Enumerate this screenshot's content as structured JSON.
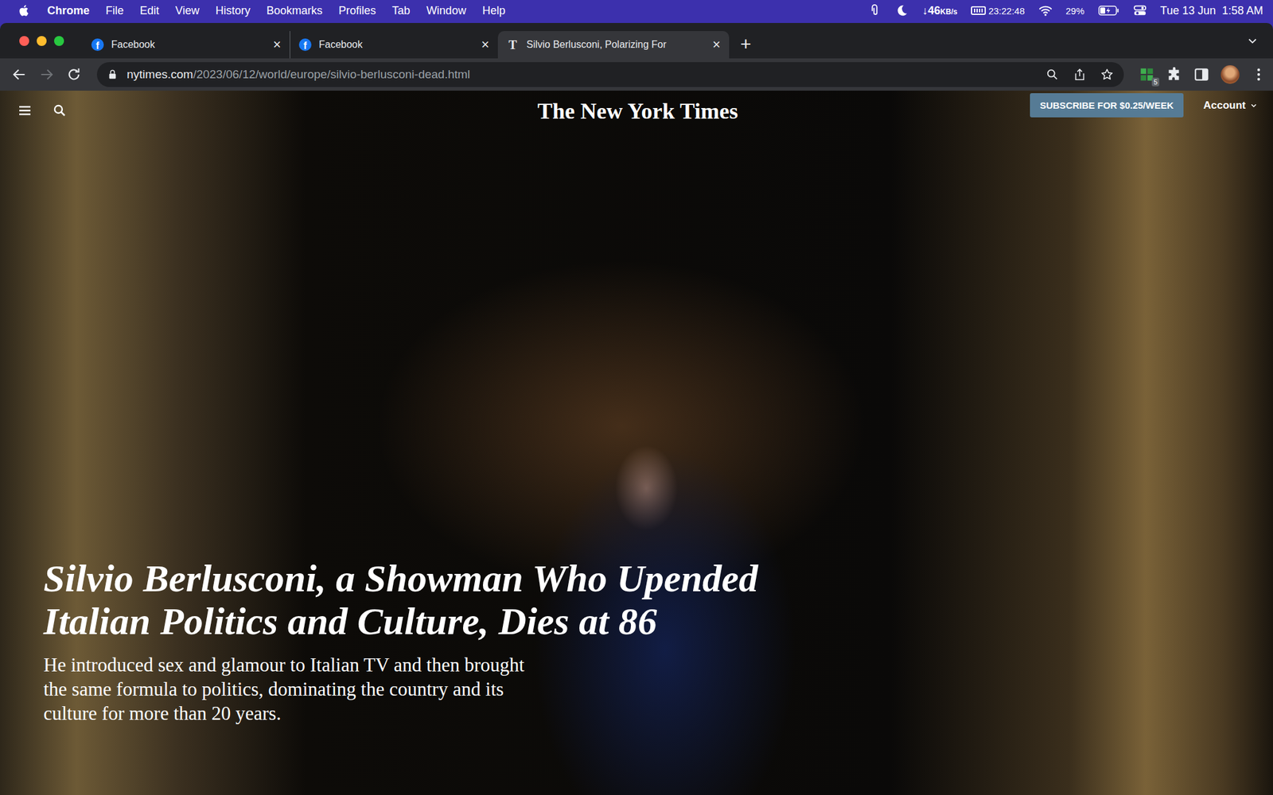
{
  "menu_bar": {
    "app": "Chrome",
    "items": [
      "File",
      "Edit",
      "View",
      "History",
      "Bookmarks",
      "Profiles",
      "Tab",
      "Window",
      "Help"
    ],
    "network": {
      "value": "↓46",
      "unit": "KB/s"
    },
    "timer": "23:22:48",
    "battery": "29%",
    "clock": "Tue 13 Jun  1:58 AM"
  },
  "tabs": [
    {
      "label": "Facebook",
      "favicon": "f",
      "kind": "facebook",
      "selected": false,
      "close": "×"
    },
    {
      "label": "Facebook",
      "favicon": "f",
      "kind": "facebook",
      "selected": false,
      "close": "×"
    },
    {
      "label": "Silvio Berlusconi, Polarizing For",
      "favicon": "T",
      "kind": "nyt",
      "selected": true,
      "close": "×"
    }
  ],
  "new_tab": "+",
  "toolbar": {
    "url_host": "nytimes.com",
    "url_path": "/2023/06/12/world/europe/silvio-berlusconi-dead.html",
    "back_disabled": false,
    "forward_disabled": true,
    "extension_badge": "5"
  },
  "page": {
    "logo": "The New York Times",
    "subscribe": "SUBSCRIBE FOR $0.25/WEEK",
    "account": "Account",
    "headline_lines": [
      "Silvio Berlusconi, a Showman Who Upended",
      "Italian Politics and Culture, Dies at 86"
    ],
    "summary_lines": [
      "He introduced sex and glamour to Italian TV and then brought",
      "the same formula to politics, dominating the country and its",
      "culture for more than 20 years."
    ]
  }
}
